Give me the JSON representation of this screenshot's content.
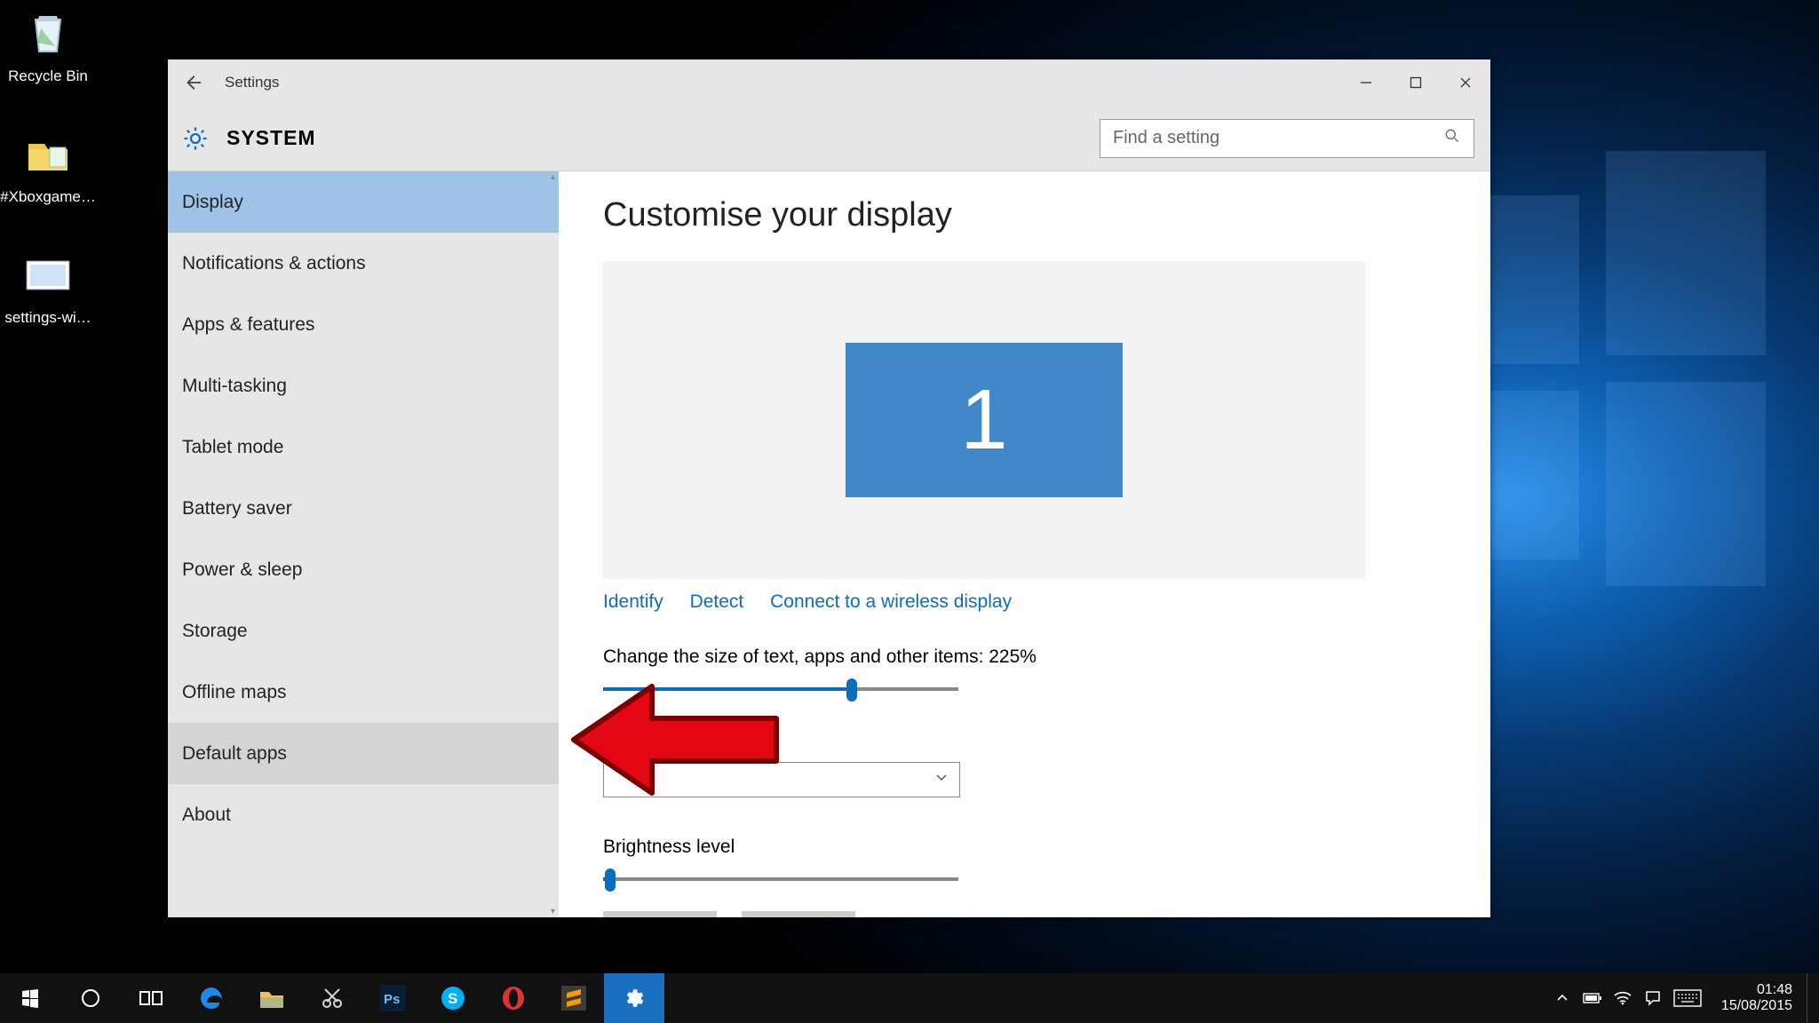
{
  "desktop": {
    "icons": [
      {
        "name": "recycle-bin",
        "label": "Recycle Bin"
      },
      {
        "name": "xboxgame-folder",
        "label": "#Xboxgame…"
      },
      {
        "name": "settings-image",
        "label": "settings-wi…"
      }
    ]
  },
  "window": {
    "title": "Settings",
    "category": "SYSTEM",
    "search_placeholder": "Find a setting",
    "nav": [
      "Display",
      "Notifications & actions",
      "Apps & features",
      "Multi-tasking",
      "Tablet mode",
      "Battery saver",
      "Power & sleep",
      "Storage",
      "Offline maps",
      "Default apps",
      "About"
    ],
    "nav_selected_index": 0,
    "nav_hover_index": 9
  },
  "content": {
    "heading": "Customise your display",
    "monitor_number": "1",
    "links": {
      "identify": "Identify",
      "detect": "Detect",
      "wireless": "Connect to a wireless display"
    },
    "scale_label": "Change the size of text, apps and other items: 225%",
    "scale_slider": {
      "percent": 70
    },
    "brightness_label": "Brightness level",
    "brightness_slider": {
      "percent": 2
    }
  },
  "taskbar": {
    "clock_time": "01:48",
    "clock_date": "15/08/2015"
  }
}
